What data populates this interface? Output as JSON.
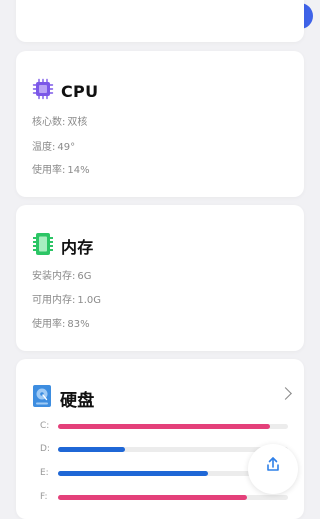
{
  "capsule": {
    "more_icon": "more-dots-icon",
    "close_icon": "target-icon"
  },
  "cpu": {
    "title": "CPU",
    "icon": "cpu-chip-icon",
    "accent": "#7b57e8",
    "cores_label": "核心数:",
    "cores_value": "双核",
    "temp_label": "温度:",
    "temp_value": "49°",
    "usage_label": "使用率:",
    "usage_value": "14%"
  },
  "memory": {
    "title": "内存",
    "icon": "memory-stick-icon",
    "accent": "#2cc565",
    "installed_label": "安装内存:",
    "installed_value": "6G",
    "available_label": "可用内存:",
    "available_value": "1.0G",
    "usage_label": "使用率:",
    "usage_value": "83%"
  },
  "disk": {
    "title": "硬盘",
    "icon": "hard-disk-icon",
    "accent": "#3d8de0",
    "drives": [
      {
        "label": "C:",
        "usage": 0.92,
        "color": "#e4407a"
      },
      {
        "label": "D:",
        "usage": 0.29,
        "color": "#1f67d6"
      },
      {
        "label": "E:",
        "usage": 0.65,
        "color": "#1f67d6"
      },
      {
        "label": "F:",
        "usage": 0.82,
        "color": "#e4407a"
      }
    ]
  },
  "fab": {
    "icon": "share-upload-icon"
  }
}
